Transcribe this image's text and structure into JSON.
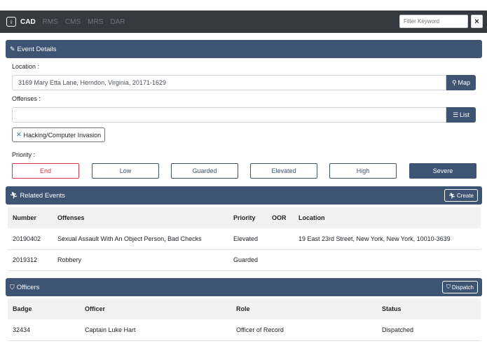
{
  "topbar": {
    "logo_icon": "info-icon",
    "nav": [
      {
        "label": "CAD",
        "active": true
      },
      {
        "label": "RMS",
        "active": false
      },
      {
        "label": "CMS",
        "active": false
      },
      {
        "label": "MRS",
        "active": false
      },
      {
        "label": "DAR",
        "active": false
      }
    ],
    "filter_placeholder": "Filter Keyword",
    "close_label": "×"
  },
  "event_details": {
    "title": "Event Details",
    "location_label": "Location :",
    "location_value": "3169 Mary Etta Lane, Herndon, Virginia, 20171-1629",
    "map_label": "Map",
    "offenses_label": "Offenses :",
    "offenses_value": "",
    "list_label": "List",
    "offense_tag": "Hacking/Computer Invasion",
    "priority_label": "Priority :",
    "priorities": [
      "End",
      "Low",
      "Guarded",
      "Elevated",
      "High",
      "Severe"
    ],
    "selected_priority": "Severe"
  },
  "related_events": {
    "title": "Related Events",
    "create_label": "Create",
    "columns": [
      "Number",
      "Offenses",
      "Priority",
      "OOR",
      "Location"
    ],
    "rows": [
      {
        "number": "20190402",
        "offenses": "Sexual Assault With An Object Person, Bad Checks",
        "priority": "Elevated",
        "oor": "",
        "location": "19 East 23rd Street, New York, New York, 10010-3639"
      },
      {
        "number": "2019312",
        "offenses": "Robbery",
        "priority": "Guarded",
        "oor": "",
        "location": ""
      }
    ]
  },
  "officers": {
    "title": "Officers",
    "dispatch_label": "Dispatch",
    "columns": [
      "Badge",
      "Officer",
      "Role",
      "Status"
    ],
    "rows": [
      {
        "badge": "32434",
        "officer": "Captain Luke Hart",
        "role": "Officer of Record",
        "status": "Dispatched"
      }
    ]
  },
  "colors": {
    "header": "#3d5473",
    "topbar": "#343a40",
    "danger": "#dc3545"
  }
}
